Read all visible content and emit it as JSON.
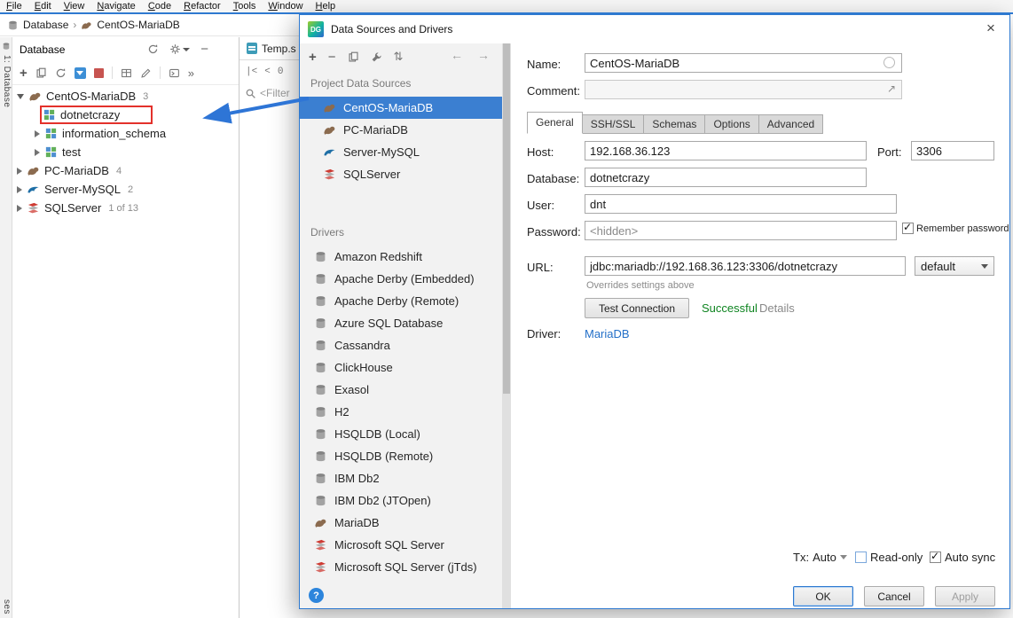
{
  "colors": {
    "selection": "#3B7FD1",
    "dialog_border": "#2E79D0",
    "success": "#0E8420",
    "link": "#2470C8",
    "annotation_red": "#E3312B",
    "annotation_blue": "#2E75D6"
  },
  "menu": {
    "items": [
      "File",
      "Edit",
      "View",
      "Navigate",
      "Code",
      "Refactor",
      "Tools",
      "Window",
      "Help"
    ]
  },
  "breadcrumb": {
    "root": "Database",
    "separator": "›",
    "current": "CentOS-MariaDB"
  },
  "tool_strip": {
    "database_button": "1: Database",
    "bottom_button": "ses"
  },
  "db_panel": {
    "title": "Database",
    "overflow_glyph": "»",
    "tree": [
      {
        "label": "CentOS-MariaDB",
        "badge": "3"
      },
      {
        "label": "dotnetcrazy"
      },
      {
        "label": "information_schema"
      },
      {
        "label": "test"
      },
      {
        "label": "PC-MariaDB",
        "badge": "4"
      },
      {
        "label": "Server-MySQL",
        "badge": "2"
      },
      {
        "label": "SQLServer",
        "badge": "1 of 13"
      }
    ]
  },
  "editor": {
    "tab_label": "Temp.s",
    "filter_text": "<Filter",
    "nav_zero": "0"
  },
  "dialog": {
    "title": "Data Sources and Drivers",
    "app_badge": "DG",
    "close_glyph": "×",
    "back_glyph": "←",
    "forward_glyph": "→",
    "sources_header": "Project Data Sources",
    "sources": [
      "CentOS-MariaDB",
      "PC-MariaDB",
      "Server-MySQL",
      "SQLServer"
    ],
    "drivers_header": "Drivers",
    "drivers": [
      "Amazon Redshift",
      "Apache Derby (Embedded)",
      "Apache Derby (Remote)",
      "Azure SQL Database",
      "Cassandra",
      "ClickHouse",
      "Exasol",
      "H2",
      "HSQLDB (Local)",
      "HSQLDB (Remote)",
      "IBM Db2",
      "IBM Db2 (JTOpen)",
      "MariaDB",
      "Microsoft SQL Server",
      "Microsoft SQL Server (jTds)"
    ],
    "help_glyph": "?",
    "form": {
      "name_label": "Name:",
      "name_value": "CentOS-MariaDB",
      "comment_label": "Comment:",
      "comment_value": "",
      "tabs": [
        "General",
        "SSH/SSL",
        "Schemas",
        "Options",
        "Advanced"
      ],
      "host_label": "Host:",
      "host_value": "192.168.36.123",
      "port_label": "Port:",
      "port_value": "3306",
      "database_label": "Database:",
      "database_value": "dotnetcrazy",
      "user_label": "User:",
      "user_value": "dnt",
      "password_label": "Password:",
      "password_value": "<hidden>",
      "remember_password_label": "Remember password",
      "url_label": "URL:",
      "url_value": "jdbc:mariadb://192.168.36.123:3306/dotnetcrazy",
      "url_preset": "default",
      "overrides_note": "Overrides settings above",
      "test_connection_label": "Test Connection",
      "test_status": "Successful",
      "details_label": "Details",
      "driver_label": "Driver:",
      "driver_value": "MariaDB"
    },
    "footer": {
      "tx_label": "Tx:",
      "tx_value": "Auto",
      "readonly_label": "Read-only",
      "autosync_label": "Auto sync",
      "ok_label": "OK",
      "cancel_label": "Cancel",
      "apply_label": "Apply"
    }
  }
}
